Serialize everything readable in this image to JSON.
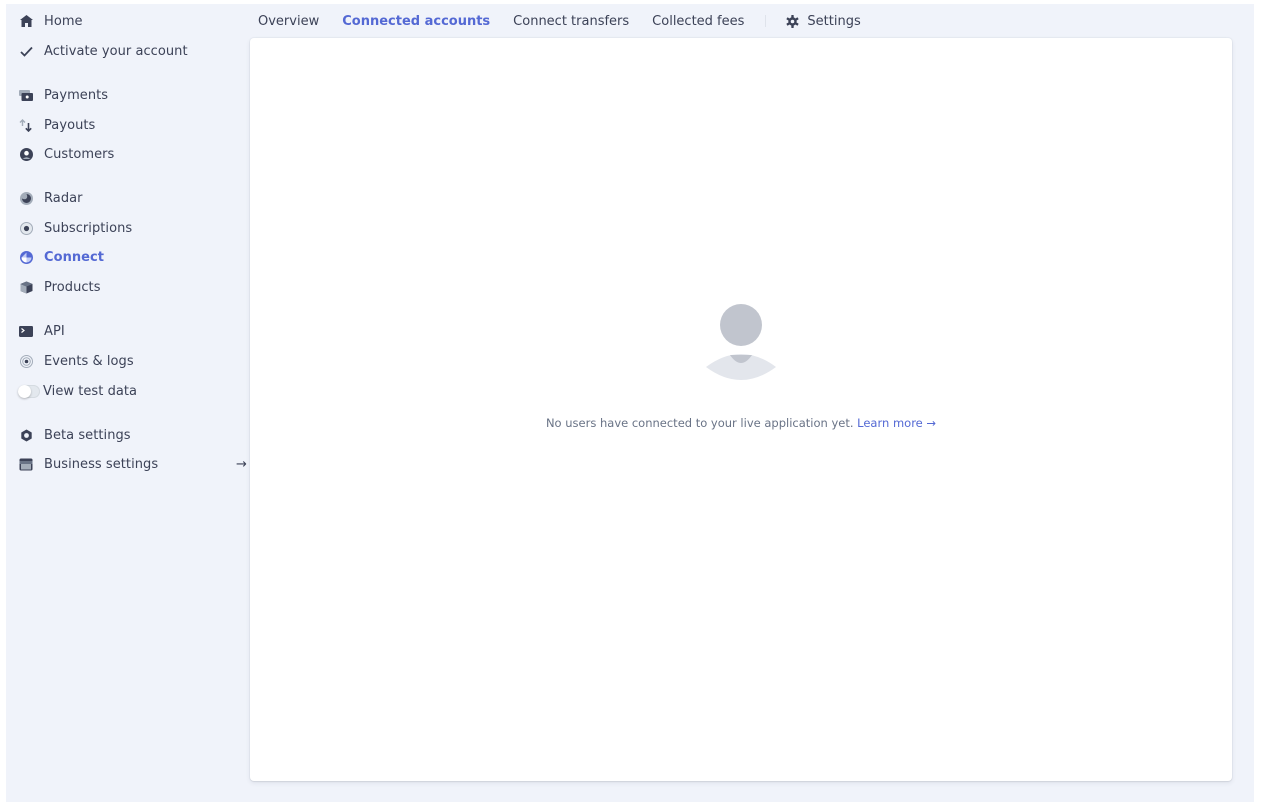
{
  "sidebar": {
    "items": [
      {
        "id": "home",
        "label": "Home",
        "icon": "home-icon",
        "active": false
      },
      {
        "id": "activate",
        "label": "Activate your account",
        "icon": "checkmark-icon",
        "active": false
      },
      {
        "id": "payments",
        "label": "Payments",
        "icon": "payments-icon",
        "active": false
      },
      {
        "id": "payouts",
        "label": "Payouts",
        "icon": "payouts-arrows-icon",
        "active": false
      },
      {
        "id": "customers",
        "label": "Customers",
        "icon": "customer-icon",
        "active": false
      },
      {
        "id": "radar",
        "label": "Radar",
        "icon": "radar-icon",
        "active": false
      },
      {
        "id": "subscriptions",
        "label": "Subscriptions",
        "icon": "subscriptions-icon",
        "active": false
      },
      {
        "id": "connect",
        "label": "Connect",
        "icon": "connect-globe-icon",
        "active": true
      },
      {
        "id": "products",
        "label": "Products",
        "icon": "products-box-icon",
        "active": false
      },
      {
        "id": "api",
        "label": "API",
        "icon": "terminal-icon",
        "active": false
      },
      {
        "id": "events",
        "label": "Events & logs",
        "icon": "events-radio-icon",
        "active": false
      },
      {
        "id": "test-data",
        "label": "View test data",
        "icon": "toggle-icon",
        "active": false,
        "toggle_on": false
      },
      {
        "id": "beta",
        "label": "Beta settings",
        "icon": "beta-gear-icon",
        "active": false
      },
      {
        "id": "business",
        "label": "Business settings",
        "icon": "store-icon",
        "active": false,
        "trailing": "→"
      }
    ]
  },
  "tabs": {
    "items": [
      {
        "label": "Overview",
        "active": false
      },
      {
        "label": "Connected accounts",
        "active": true
      },
      {
        "label": "Connect transfers",
        "active": false
      },
      {
        "label": "Collected fees",
        "active": false
      }
    ],
    "settings_label": "Settings",
    "settings_icon": "gear-icon"
  },
  "empty_state": {
    "message": "No users have connected to your live application yet.",
    "link_label": "Learn more →",
    "illustration": "user-placeholder-icon"
  },
  "colors": {
    "accent": "#5469d4",
    "text": "#3c4257",
    "muted_text": "#697386",
    "background": "#f0f3fa",
    "card": "#ffffff",
    "icon": "#3c4257",
    "placeholder_head": "#c1c5ce",
    "placeholder_body": "#e3e6ec"
  }
}
